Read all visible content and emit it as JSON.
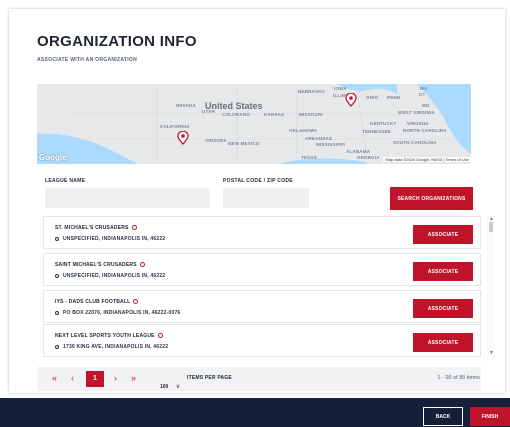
{
  "page": {
    "title": "ORGANIZATION INFO",
    "subtitle": "ASSOCIATE WITH AN ORGANIZATION"
  },
  "map": {
    "country_label": "United States",
    "labels": [
      "NEBRASKA",
      "IOWA",
      "ILLINOIS",
      "OHIO",
      "PENN",
      "NEVADA",
      "UTAH",
      "COLORADO",
      "KANSAS",
      "MISSOURI",
      "WEST VIRGINIA",
      "KENTUCKY",
      "VIRGINIA",
      "CALIFORNIA",
      "OKLAHOMA",
      "TENNESSEE",
      "NORTH CAROLINA",
      "ARIZONA",
      "NEW MEXICO",
      "ARKANSAS",
      "MISSISSIPPI",
      "SOUTH CAROLINA",
      "ALABAMA",
      "TEXAS",
      "GEORGIA",
      "MD",
      "MA",
      "CT"
    ],
    "attribution": "Map data ©2020 Google, INEGI | Terms of Use",
    "brand": "Google"
  },
  "search": {
    "league_label": "LEAGUE NAME",
    "league_value": "",
    "postal_label": "POSTAL CODE / ZIP CODE",
    "postal_value": "",
    "button_label": "SEARCH ORGANIZATIONS"
  },
  "results": [
    {
      "name": "ST. MICHAEL'S CRUSADERS",
      "address": "UNSPECIFIED, INDIANAPOLIS IN, 46222",
      "action": "ASSOCIATE"
    },
    {
      "name": "SAINT MICHAEL'S CRUSADERS",
      "address": "UNSPECIFIED, INDIANAPOLIS IN, 46222",
      "action": "ASSOCIATE"
    },
    {
      "name": "IYS - DADS CLUB FOOTBALL",
      "address": "PO BOX 22076, INDIANAPOLIS IN, 46222-0076",
      "action": "ASSOCIATE"
    },
    {
      "name": "NEXT LEVEL SPORTS YOUTH LEAGUE",
      "address": "1736 KING AVE, INDIANAPOLIS IN, 46222",
      "action": "ASSOCIATE"
    }
  ],
  "pager": {
    "first": "«",
    "prev": "‹",
    "current": "1",
    "next": "›",
    "last": "»",
    "per_page": "100",
    "per_page_label": "ITEMS PER PAGE",
    "count_text": "1 - 95 of 95 items"
  },
  "footer": {
    "back_label": "BACK",
    "finish_label": "FINISH"
  },
  "colors": {
    "accent": "#c0142a",
    "navy": "#16203a"
  }
}
